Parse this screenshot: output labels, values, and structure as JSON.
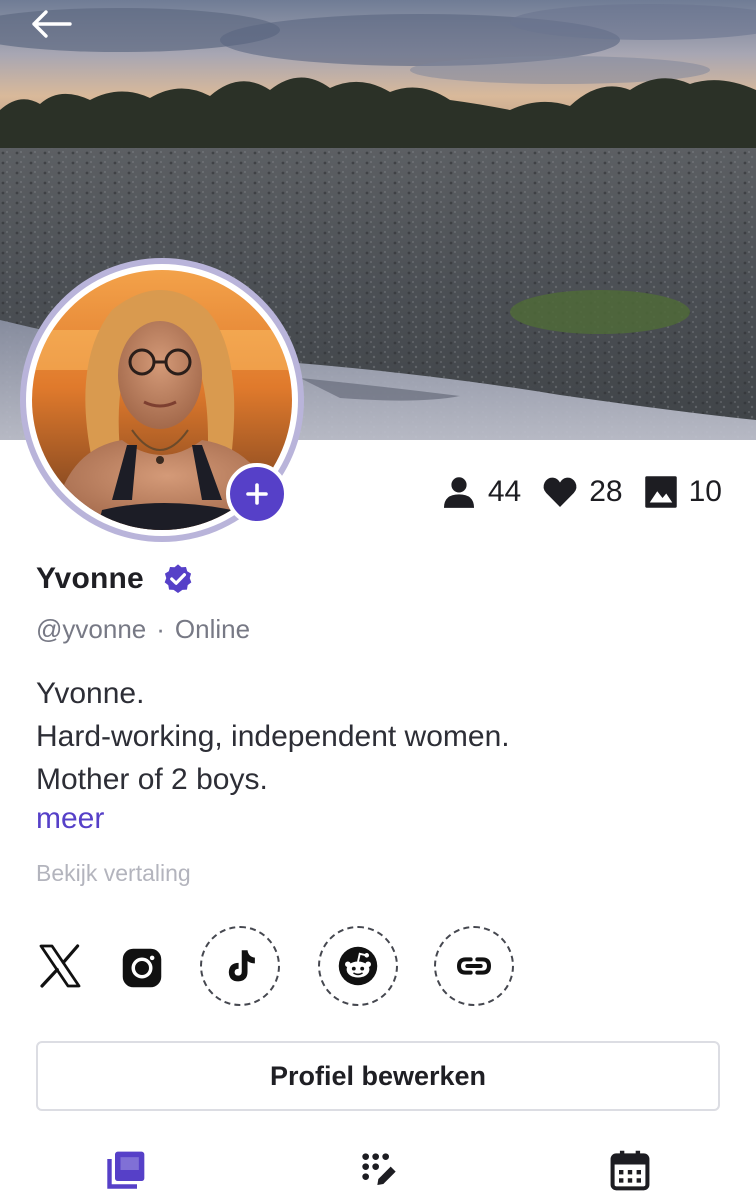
{
  "profile": {
    "name": "Yvonne",
    "handle": "@yvonne",
    "separator": "·",
    "status": "Online",
    "bio_lines": [
      "Yvonne.",
      "Hard-working, independent women.",
      "Mother of 2 boys."
    ],
    "more_label": "meer",
    "translate_label": "Bekijk vertaling",
    "verified": true
  },
  "stats": {
    "followers": "44",
    "likes": "28",
    "media": "10"
  },
  "socials": [
    "x-icon",
    "instagram-icon",
    "tiktok-icon",
    "reddit-icon",
    "link-icon"
  ],
  "actions": {
    "edit_profile_label": "Profiel bewerken"
  },
  "tabs": [
    {
      "icon": "posts-icon",
      "active": true
    },
    {
      "icon": "edit-grid-icon",
      "active": false
    },
    {
      "icon": "calendar-icon",
      "active": false
    }
  ],
  "colors": {
    "accent": "#5640c8",
    "avatar_ring": "#b9b4da",
    "muted_text": "#777985",
    "faint_text": "#b3b4bd"
  }
}
